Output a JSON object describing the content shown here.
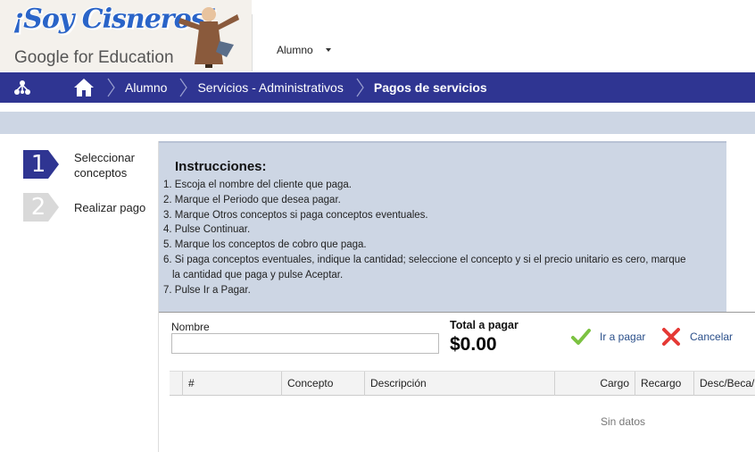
{
  "header": {
    "logo_title": "¡Soy Cisneros!",
    "logo_subtitle_brand": "Google",
    "logo_subtitle_rest": " for Education",
    "user_menu_label": "Alumno"
  },
  "nav": {
    "breadcrumbs": [
      "Alumno",
      "Servicios - Administrativos",
      "Pagos de servicios"
    ]
  },
  "steps": [
    {
      "number": "1",
      "label": "Seleccionar conceptos",
      "active": true
    },
    {
      "number": "2",
      "label": "Realizar pago",
      "active": false
    }
  ],
  "instructions": {
    "title": "Instrucciones:",
    "items": [
      "1. Escoja el nombre del cliente que paga.",
      "2. Marque el Periodo que desea pagar.",
      "3. Marque Otros conceptos si paga conceptos eventuales.",
      "4. Pulse Continuar.",
      "5. Marque los conceptos de cobro que paga.",
      "6. Si paga conceptos eventuales, indique la cantidad; seleccione el concepto y si el precio unitario es cero, marque",
      "la cantidad que paga y pulse Aceptar.",
      "7. Pulse Ir a Pagar."
    ]
  },
  "form": {
    "nombre_label": "Nombre",
    "nombre_value": "",
    "total_label": "Total a pagar",
    "total_value": "$0.00",
    "pay_button": "Ir a pagar",
    "cancel_button": "Cancelar"
  },
  "table": {
    "columns": [
      "#",
      "Concepto",
      "Descripción",
      "Cargo",
      "Recargo",
      "Desc/Beca/C"
    ],
    "empty_text": "Sin datos"
  },
  "colors": {
    "nav_bg": "#2f3592",
    "panel_bg": "#cdd6e4",
    "step_active": "#2f3592",
    "step_inactive": "#d9d9d9",
    "check": "#7cc242",
    "cross": "#e53935"
  }
}
